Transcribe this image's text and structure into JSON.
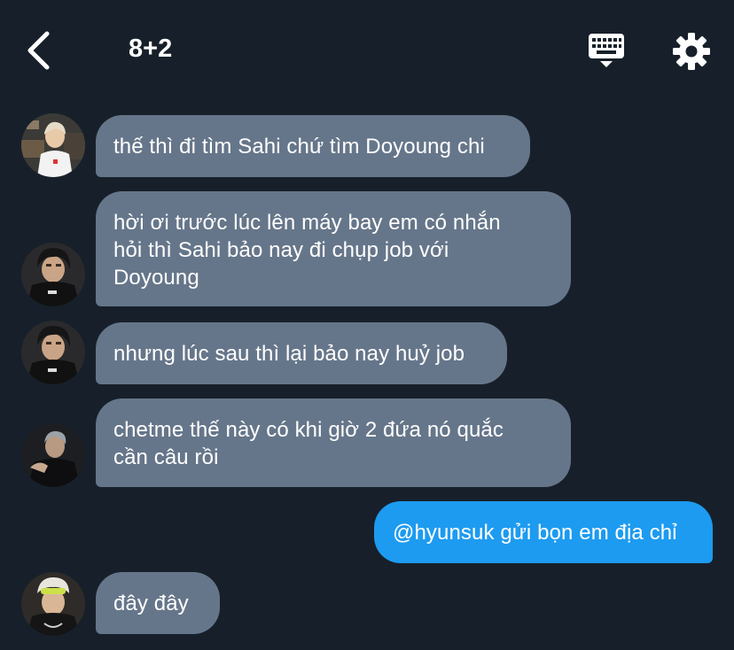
{
  "header": {
    "back_icon": "chevron-left-icon",
    "title": "8+2",
    "keyboard_icon": "keyboard-icon",
    "settings_icon": "gear-icon"
  },
  "colors": {
    "background": "#17202a",
    "incoming_bubble": "#66768a",
    "outgoing_bubble": "#1d9bf0",
    "text": "#ffffff"
  },
  "messages": [
    {
      "direction": "incoming",
      "text": "thế thì đi tìm Sahi chứ tìm Doyoung chi"
    },
    {
      "direction": "incoming",
      "text": "hời ơi trước lúc lên máy bay em có nhắn\nhỏi thì Sahi bảo nay đi chụp job với\nDoyoung"
    },
    {
      "direction": "incoming",
      "text": "nhưng lúc sau thì lại bảo nay huỷ job"
    },
    {
      "direction": "incoming",
      "text": "chetme thế này có khi giờ 2 đứa nó quắc\ncần câu rồi"
    },
    {
      "direction": "outgoing",
      "text": "@hyunsuk gửi bọn em địa chỉ"
    },
    {
      "direction": "incoming",
      "text": "đây đây"
    }
  ]
}
